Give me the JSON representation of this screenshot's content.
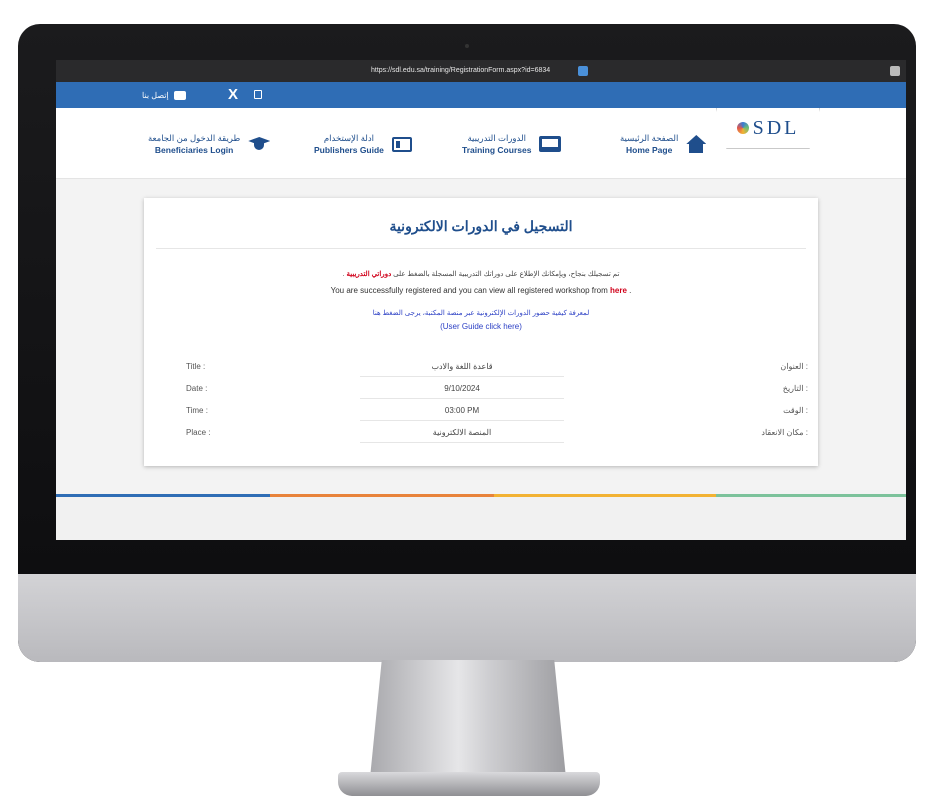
{
  "browser": {
    "url": "https://sdl.edu.sa/training/RegistrationForm.aspx?id=6834"
  },
  "topbar": {
    "contact_label": "إتصل بنا",
    "x_glyph": "X"
  },
  "nav": {
    "beneficiaries": {
      "ar": "طريقة الدخول من الجامعة",
      "en": "Beneficiaries Login"
    },
    "publishers": {
      "ar": "ادلة الإستخدام",
      "en": "Publishers Guide"
    },
    "training": {
      "ar": "الدورات التدريبية",
      "en": "Training Courses"
    },
    "home": {
      "ar": "الصفحة الرئيسية",
      "en": "Home Page"
    },
    "logo_text": "SDL"
  },
  "card": {
    "title": "التسجيل في الدورات الالكترونية",
    "msg_ar_prefix": "تم تسجيلك بنجاح، ويإمكانك الإطلاع على دوراتك التدريبية المسجلة بالضغط على ",
    "msg_ar_link": "دوراتي التدريبية",
    "msg_ar_suffix": " .",
    "msg_en_prefix": "You are successfully registered and you can view all registered workshop from ",
    "msg_en_link": "here",
    "msg_en_suffix": " .",
    "guide_ar": "لمعرفة كيفية حضور الدورات الإلكترونية عبر منصة المكتبة، يرجى الضغط هنا",
    "guide_en": "(User Guide click here)",
    "fields": [
      {
        "label_en": "Title :",
        "value": "قاعدة اللغة والادب",
        "label_ar": "العنوان :"
      },
      {
        "label_en": "Date :",
        "value": "9/10/2024",
        "label_ar": "التاريخ :"
      },
      {
        "label_en": "Time :",
        "value": "03:00 PM",
        "label_ar": "الوقت :"
      },
      {
        "label_en": "Place :",
        "value": "المنصة الالكترونية",
        "label_ar": "مكان الانعقاد :"
      }
    ]
  },
  "colors": {
    "brand_blue": "#2f6db5",
    "accent_red": "#d0021b",
    "bar": [
      "#2f6db5",
      "#e8833a",
      "#f2b233",
      "#7cc29b"
    ]
  }
}
